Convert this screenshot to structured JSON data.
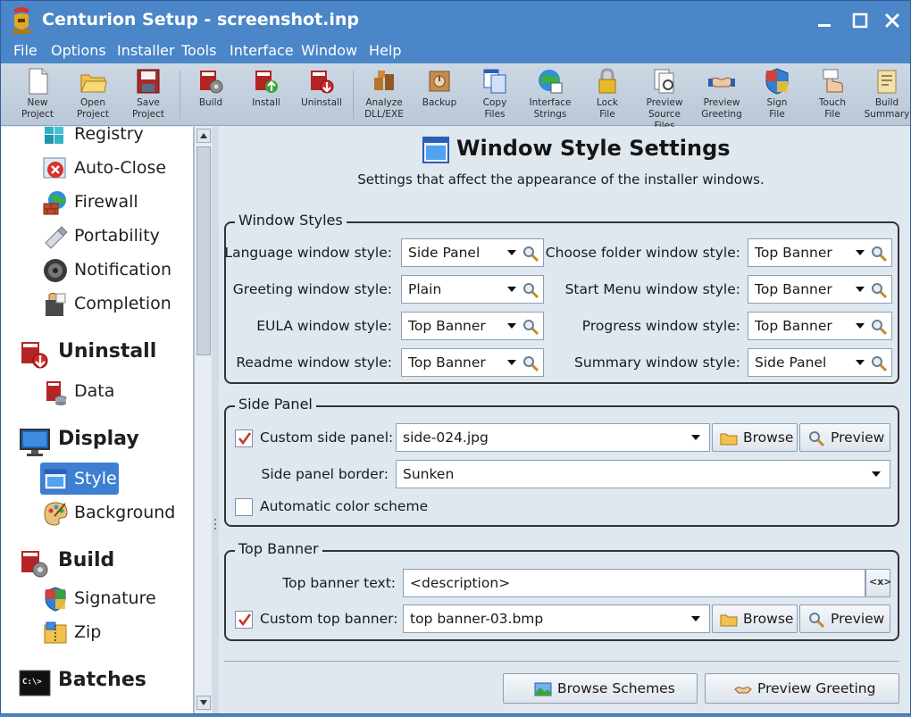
{
  "window": {
    "title": "Centurion Setup - screenshot.inp"
  },
  "menu": [
    "File",
    "Options",
    "Installer",
    "Tools",
    "Interface",
    "Window",
    "Help"
  ],
  "toolbar": [
    {
      "l1": "New",
      "l2": "Project",
      "icon": "new-project-icon"
    },
    {
      "l1": "Open",
      "l2": "Project",
      "icon": "open-project-icon"
    },
    {
      "l1": "Save",
      "l2": "Project",
      "icon": "save-project-icon"
    },
    {
      "l1": "Build",
      "l2": "",
      "icon": "build-icon"
    },
    {
      "l1": "Install",
      "l2": "",
      "icon": "install-icon"
    },
    {
      "l1": "Uninstall",
      "l2": "",
      "icon": "uninstall-icon"
    },
    {
      "l1": "Analyze",
      "l2": "DLL/EXE",
      "icon": "analyze-icon"
    },
    {
      "l1": "Backup",
      "l2": "",
      "icon": "backup-icon"
    },
    {
      "l1": "Copy",
      "l2": "Files",
      "icon": "copy-files-icon"
    },
    {
      "l1": "Interface",
      "l2": "Strings",
      "icon": "interface-strings-icon"
    },
    {
      "l1": "Lock",
      "l2": "File",
      "icon": "lock-icon"
    },
    {
      "l1": "Preview",
      "l2": "Source Files",
      "icon": "preview-source-icon"
    },
    {
      "l1": "Preview",
      "l2": "Greeting",
      "icon": "preview-greeting-icon"
    },
    {
      "l1": "Sign",
      "l2": "File",
      "icon": "sign-icon"
    },
    {
      "l1": "Touch",
      "l2": "File",
      "icon": "touch-icon"
    },
    {
      "l1": "Build",
      "l2": "Summary",
      "icon": "build-summary-icon"
    }
  ],
  "sidebar": {
    "items": [
      "Registry",
      "Auto-Close",
      "Firewall",
      "Portability",
      "Notification",
      "Completion"
    ],
    "uninstall": "Uninstall",
    "uninstall_items": [
      "Data"
    ],
    "display": "Display",
    "display_items": [
      "Style",
      "Background"
    ],
    "build": "Build",
    "build_items": [
      "Signature",
      "Zip"
    ],
    "batches": "Batches"
  },
  "page": {
    "title": "Window Style Settings",
    "subtitle": "Settings that affect the appearance of the installer windows."
  },
  "window_styles": {
    "title": "Window Styles",
    "left": [
      {
        "label": "Language window style:",
        "value": "Side Panel"
      },
      {
        "label": "Greeting window style:",
        "value": "Plain"
      },
      {
        "label": "EULA window style:",
        "value": "Top Banner"
      },
      {
        "label": "Readme window style:",
        "value": "Top Banner"
      }
    ],
    "right": [
      {
        "label": "Choose folder window style:",
        "value": "Top Banner"
      },
      {
        "label": "Start Menu window style:",
        "value": "Top Banner"
      },
      {
        "label": "Progress window style:",
        "value": "Top Banner"
      },
      {
        "label": "Summary window style:",
        "value": "Side Panel"
      }
    ]
  },
  "side_panel": {
    "title": "Side Panel",
    "custom_label": "Custom side panel:",
    "custom_value": "side-024.jpg",
    "custom_checked": true,
    "border_label": "Side panel border:",
    "border_value": "Sunken",
    "auto_color_label": "Automatic color scheme",
    "auto_color_checked": false,
    "browse": "Browse",
    "preview": "Preview"
  },
  "top_banner": {
    "title": "Top Banner",
    "text_label": "Top banner text:",
    "text_value": "<description>",
    "var_button": "<x>",
    "custom_label": "Custom top banner:",
    "custom_value": "top banner-03.bmp",
    "custom_checked": true,
    "browse": "Browse",
    "preview": "Preview"
  },
  "footer": {
    "browse_schemes": "Browse Schemes",
    "preview_greeting": "Preview Greeting"
  }
}
